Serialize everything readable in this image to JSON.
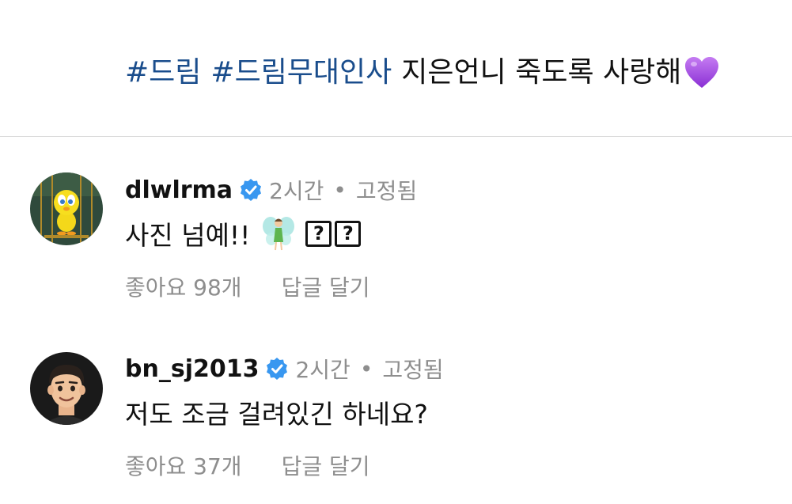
{
  "caption": {
    "hashtags": [
      "#드림",
      "#드림무대인사"
    ],
    "text": "지은언니 죽도록 사랑해",
    "emoji": "purple-heart-icon"
  },
  "comments": [
    {
      "username": "dlwlrma",
      "verified": true,
      "time": "2시간",
      "separator": "•",
      "pinned": "고정됨",
      "text": "사진 넘예!!",
      "emoji": "fairy-icon",
      "trailing_glyphs": [
        "?",
        "?"
      ],
      "likes": "좋아요 98개",
      "reply_label": "답글 달기",
      "avatar": "tweety-bird-avatar"
    },
    {
      "username": "bn_sj2013",
      "verified": true,
      "time": "2시간",
      "separator": "•",
      "pinned": "고정됨",
      "text": "저도 조금 걸려있긴 하네요?",
      "likes": "좋아요 37개",
      "reply_label": "답글 달기",
      "avatar": "memoji-avatar"
    }
  ],
  "colors": {
    "hashtag": "#1a4d8c",
    "verified": "#3897f0",
    "secondary_text": "#8e8e8e",
    "heart": "#a349e0"
  }
}
